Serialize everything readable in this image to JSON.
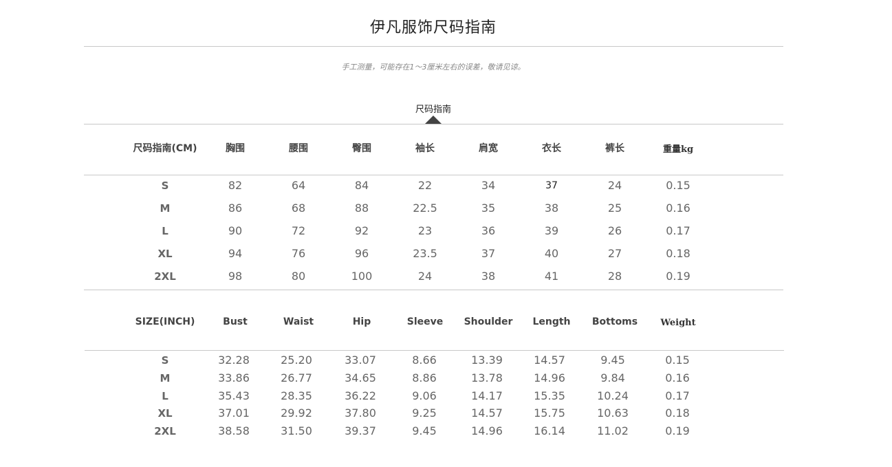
{
  "page": {
    "title": "伊凡服饰尺码指南",
    "note": "手工测量，可能存在1～3厘米左右的误差，敬请见谅。",
    "section_tab": "尺码指南"
  },
  "cm_table": {
    "headers": [
      "尺码指南(CM)",
      "胸围",
      "腰围",
      "臀围",
      "袖长",
      "肩宽",
      "衣长",
      "裤长",
      "重量kg"
    ],
    "rows": [
      [
        "S",
        "82",
        "64",
        "84",
        "22",
        "34",
        "37",
        "24",
        "0.15"
      ],
      [
        "M",
        "86",
        "68",
        "88",
        "22.5",
        "35",
        "38",
        "25",
        "0.16"
      ],
      [
        "L",
        "90",
        "72",
        "92",
        "23",
        "36",
        "39",
        "26",
        "0.17"
      ],
      [
        "XL",
        "94",
        "76",
        "96",
        "23.5",
        "37",
        "40",
        "27",
        "0.18"
      ],
      [
        "2XL",
        "98",
        "80",
        "100",
        "24",
        "38",
        "41",
        "28",
        "0.19"
      ]
    ]
  },
  "inch_table": {
    "headers": [
      "SIZE(INCH)",
      "Bust",
      "Waist",
      "Hip",
      "Sleeve",
      "Shoulder",
      "Length",
      "Bottoms",
      "Weight"
    ],
    "rows": [
      [
        "S",
        "32.28",
        "25.20",
        "33.07",
        "8.66",
        "13.39",
        "14.57",
        "9.45",
        "0.15"
      ],
      [
        "M",
        "33.86",
        "26.77",
        "34.65",
        "8.86",
        "13.78",
        "14.96",
        "9.84",
        "0.16"
      ],
      [
        "L",
        "35.43",
        "28.35",
        "36.22",
        "9.06",
        "14.17",
        "15.35",
        "10.24",
        "0.17"
      ],
      [
        "XL",
        "37.01",
        "29.92",
        "37.80",
        "9.25",
        "14.57",
        "15.75",
        "10.63",
        "0.18"
      ],
      [
        "2XL",
        "38.58",
        "31.50",
        "39.37",
        "9.45",
        "14.96",
        "16.14",
        "11.02",
        "0.19"
      ]
    ]
  }
}
